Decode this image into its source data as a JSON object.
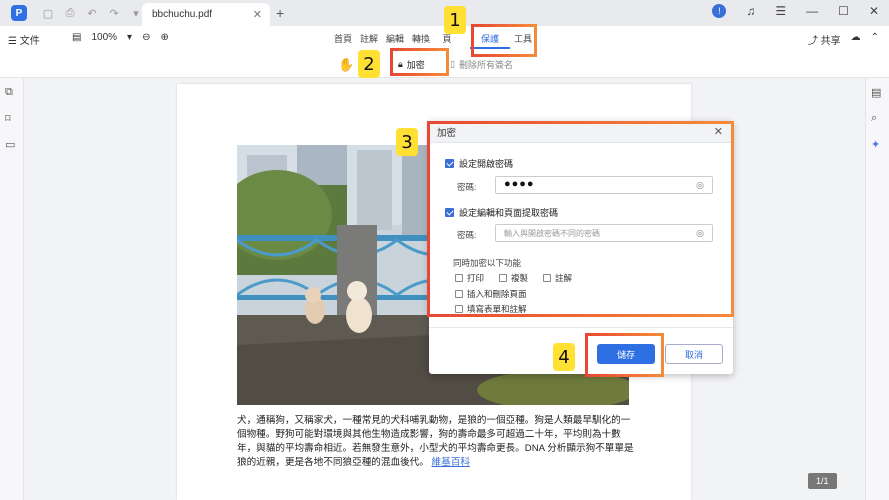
{
  "app": {
    "logo_letter": "P",
    "doc_tab": "bbchuchu.pdf"
  },
  "menubar": {
    "file": "文件",
    "zoom": "100%",
    "tabs": [
      "首頁",
      "註解",
      "編輯",
      "轉換",
      "頁",
      "保護",
      "工具"
    ],
    "share": "共享"
  },
  "subbar": {
    "encrypt": "加密",
    "remove_security": "刪除所有簽名"
  },
  "callouts": [
    "1",
    "2",
    "3",
    "4"
  ],
  "dialog": {
    "title": "加密",
    "open_pw_label": "設定開啟密碼",
    "pw_label": "密碼:",
    "pw_value": "●●●●",
    "edit_pw_label": "設定編輯和頁面提取密碼",
    "pw_label2": "密碼:",
    "pw_placeholder": "輸入與開啟密碼不同的密碼",
    "perm_title": "同時加密以下功能",
    "perms": [
      "打印",
      "複製",
      "註解",
      "插入和刪除頁面",
      "填寫表單和註解"
    ],
    "save": "儲存",
    "cancel": "取消"
  },
  "page": {
    "body_text": "犬，通稱狗，又稱家犬，一種常見的犬科哺乳動物，是狼的一個亞種。狗是人類最早馴化的一個物種。野狗可能對環境與其他生物造成影響，狗的壽命最多可超過二十年，平均則為十數年，與貓的平均壽命相近。若無發生意外，小型犬的平均壽命更長。DNA 分析顯示狗不單單是狼的近親，更是各地不同狼亞種的混血後代。",
    "link_text": "維基百科",
    "page_indicator": "1/1"
  }
}
